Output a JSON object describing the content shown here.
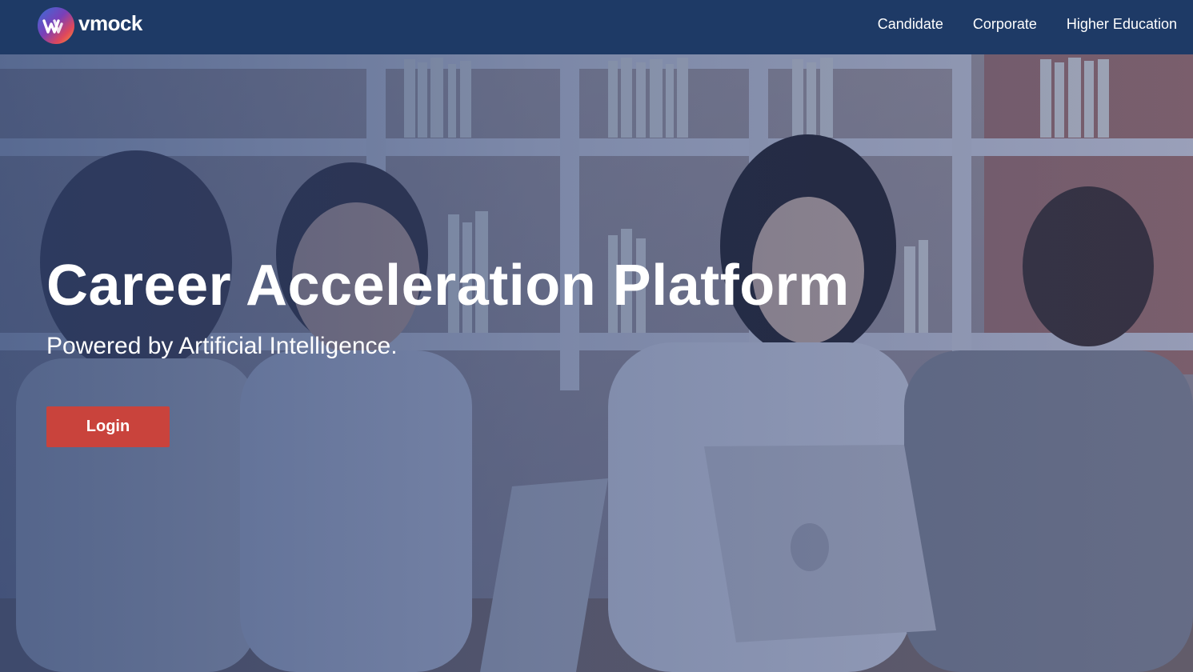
{
  "brand": {
    "name": "vmock",
    "logo_icon": "vmock-logo-icon"
  },
  "nav": {
    "links": [
      {
        "label": "Candidate"
      },
      {
        "label": "Corporate"
      },
      {
        "label": "Higher Education"
      }
    ]
  },
  "hero": {
    "title": "Career Acceleration Platform",
    "subtitle": "Powered by Artificial Intelligence.",
    "login_label": "Login"
  },
  "colors": {
    "navbar": "#1e3a66",
    "overlay": "#203a6e",
    "login_button": "#c9433c",
    "text": "#ffffff"
  }
}
